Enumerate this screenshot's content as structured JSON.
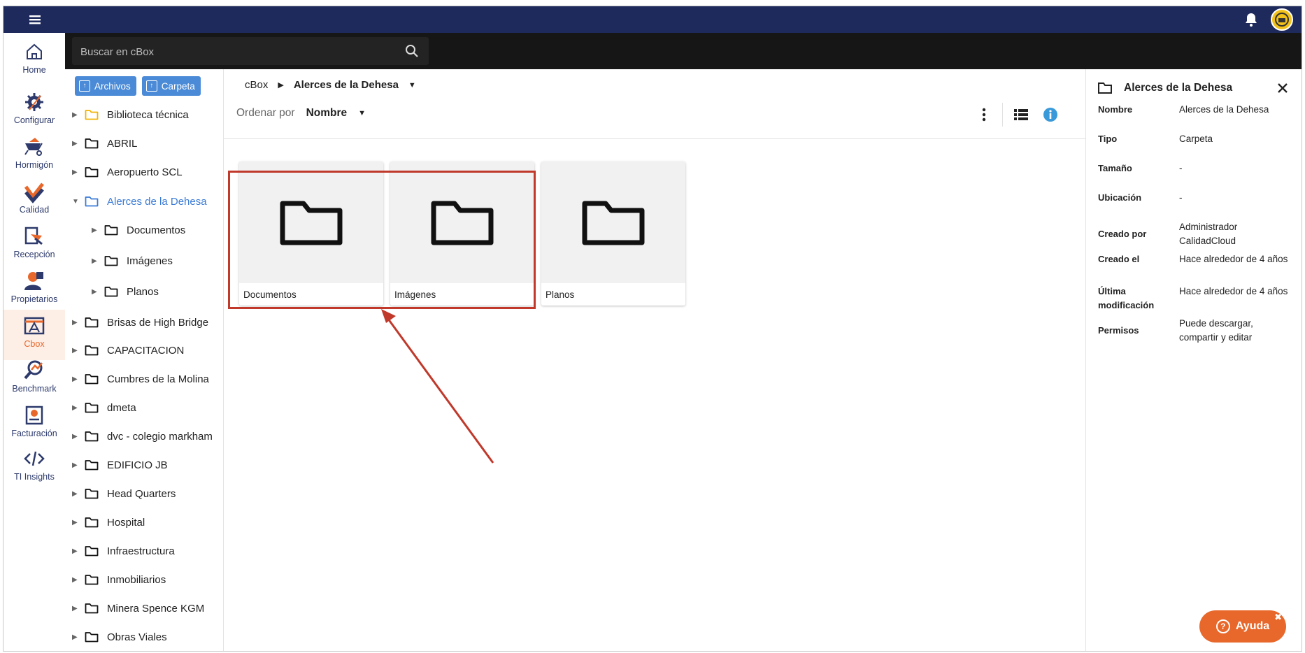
{
  "topbar": {},
  "nav": [
    {
      "label": "Home",
      "icon": "home-icon"
    },
    {
      "label": "Configurar",
      "icon": "gear-icon"
    },
    {
      "label": "Hormigón",
      "icon": "wheelbarrow-icon"
    },
    {
      "label": "Calidad",
      "icon": "quality-check-icon"
    },
    {
      "label": "Recepción",
      "icon": "reception-icon"
    },
    {
      "label": "Propietarios",
      "icon": "owners-icon"
    },
    {
      "label": "Cbox",
      "icon": "cbox-icon"
    },
    {
      "label": "Benchmark",
      "icon": "benchmark-icon"
    },
    {
      "label": "Facturación",
      "icon": "billing-icon"
    },
    {
      "label": "TI Insights",
      "icon": "code-icon"
    }
  ],
  "search": {
    "placeholder": "Buscar en cBox"
  },
  "tree": {
    "archivos_label": "Archivos",
    "carpeta_label": "Carpeta",
    "items": [
      {
        "label": "Biblioteca técnica",
        "level": 0,
        "color": "#f2b300"
      },
      {
        "label": "ABRIL",
        "level": 0
      },
      {
        "label": "Aeropuerto SCL",
        "level": 0
      },
      {
        "label": "Alerces de la Dehesa",
        "level": 0,
        "active": true
      },
      {
        "label": "Documentos",
        "level": 1
      },
      {
        "label": "Imágenes",
        "level": 1
      },
      {
        "label": "Planos",
        "level": 1
      },
      {
        "label": "Brisas de High Bridge",
        "level": 0
      },
      {
        "label": "CAPACITACION",
        "level": 0
      },
      {
        "label": "Cumbres de la Molina",
        "level": 0
      },
      {
        "label": "dmeta",
        "level": 0
      },
      {
        "label": "dvc - colegio markham",
        "level": 0
      },
      {
        "label": "EDIFICIO JB",
        "level": 0
      },
      {
        "label": "Head Quarters",
        "level": 0
      },
      {
        "label": "Hospital",
        "level": 0
      },
      {
        "label": "Infraestructura",
        "level": 0
      },
      {
        "label": "Inmobiliarios",
        "level": 0
      },
      {
        "label": "Minera Spence KGM",
        "level": 0
      },
      {
        "label": "Obras Viales",
        "level": 0
      }
    ]
  },
  "main": {
    "breadcrumb_root": "cBox",
    "breadcrumb_current": "Alerces de la Dehesa",
    "sort_label": "Ordenar por",
    "sort_value": "Nombre",
    "folders": [
      "Documentos",
      "Imágenes",
      "Planos"
    ]
  },
  "details": {
    "title": "Alerces de la Dehesa",
    "rows": [
      {
        "k": "Nombre",
        "v": "Alerces de la Dehesa"
      },
      {
        "k": "Tipo",
        "v": "Carpeta"
      },
      {
        "k": "Tamaño",
        "v": "-"
      },
      {
        "k": "Ubicación",
        "v": "-"
      },
      {
        "k": "Creado por",
        "v": "Administrador CalidadCloud"
      },
      {
        "k": "Creado el",
        "v": "Hace alrededor de 4 años"
      },
      {
        "k": "Última modificación",
        "v": "Hace alrededor de 4 años"
      },
      {
        "k": "Permisos",
        "v": "Puede descargar, compartir y editar"
      }
    ]
  },
  "help": {
    "label": "Ayuda"
  },
  "colors": {
    "topbar": "#1f2a5c",
    "accent": "#e8672a",
    "link": "#3b7bd6",
    "annotation": "#c0392b"
  }
}
